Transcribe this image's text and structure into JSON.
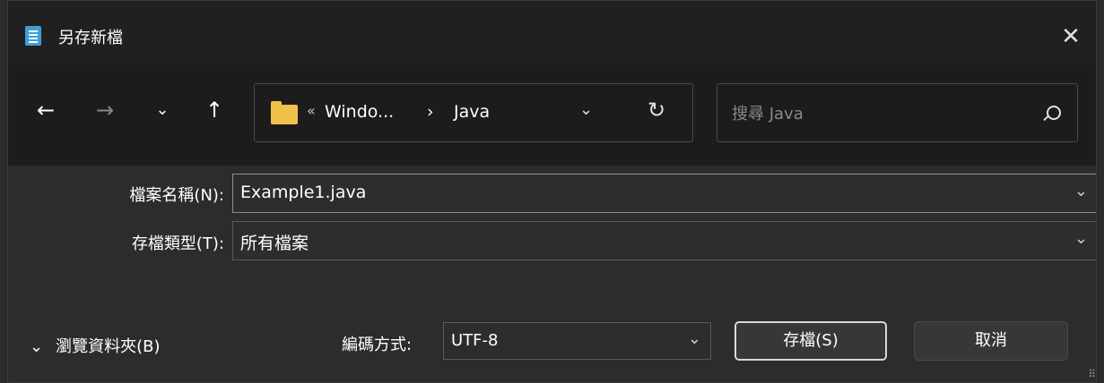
{
  "window": {
    "title": "另存新檔",
    "close_icon": "close-icon",
    "app_icon": "notepad-icon"
  },
  "nav": {
    "back": "←",
    "forward": "→",
    "recent": "⌄",
    "up": "↑",
    "address": {
      "overflow": "«",
      "segments": [
        "Windo...",
        "Java"
      ],
      "separator": "›",
      "dropdown": "⌄",
      "refresh": "↻"
    },
    "search": {
      "placeholder": "搜尋 Java",
      "value": ""
    }
  },
  "form": {
    "filename_label": "檔案名稱(N):",
    "filename_value": "Example1.java",
    "filetype_label": "存檔類型(T):",
    "filetype_value": "所有檔案"
  },
  "footer": {
    "browse_label": "瀏覽資料夾(B)",
    "browse_icon": "⌄",
    "encoding_label": "編碼方式:",
    "encoding_value": "UTF-8",
    "save_label": "存檔(S)",
    "cancel_label": "取消",
    "grip": "⠿"
  },
  "colors": {
    "title_bg": "#202020",
    "nav_bg": "#1c1c1c",
    "body_bg": "#2c2c2c",
    "folder": "#f2c14b",
    "app_icon": "#3ea0d8"
  }
}
